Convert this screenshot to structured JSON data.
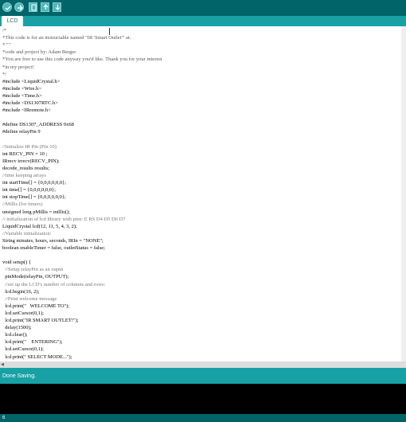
{
  "toolbar": {
    "buttons": [
      {
        "name": "verify-icon"
      },
      {
        "name": "upload-icon"
      },
      {
        "name": "new-file-icon"
      },
      {
        "name": "open-file-icon"
      },
      {
        "name": "save-file-icon"
      }
    ]
  },
  "tabs": [
    {
      "label": "LCD"
    }
  ],
  "editor": {
    "lines": [
      {
        "text": "/*",
        "color": "#555555"
      },
      {
        "text": "*This code is for an instructable named \"IR 'Smart Outlet'\" at:",
        "color": "#555555"
      },
      {
        "text": "* \"\"",
        "color": "#555555"
      },
      {
        "text": "*code and project by: Adam Berger",
        "color": "#555555"
      },
      {
        "text": "*You are free to use this code anyway you'd like. Thank you for your interest",
        "color": "#555555"
      },
      {
        "text": "*in my project!",
        "color": "#555555"
      },
      {
        "text": "*/",
        "color": "#555555"
      },
      {
        "text": "#include <LiquidCrystal.h>",
        "color": "#000000"
      },
      {
        "text": "#include <Wire.h>",
        "color": "#000000"
      },
      {
        "text": "#include <Time.h>",
        "color": "#000000"
      },
      {
        "text": "#include <DS1307RTC.h>",
        "color": "#000000"
      },
      {
        "text": "#include <IRremote.h>",
        "color": "#000000"
      },
      {
        "text": "",
        "color": "#000000"
      },
      {
        "text": "#define DS1307_ADDRESS 0x68",
        "color": "#000000"
      },
      {
        "text": "#define relayPin 9",
        "color": "#000000"
      },
      {
        "text": "",
        "color": "#000000"
      },
      {
        "text": "//Initialize IR Pin (Pin 10)",
        "color": "#777777"
      },
      {
        "text": "int RECV_PIN = 10 ;",
        "color": "#000000"
      },
      {
        "text": "IRrecv irrecv(RECV_PIN);",
        "color": "#000000"
      },
      {
        "text": "decode_results results;",
        "color": "#000000"
      },
      {
        "text": "//time keeping arrays",
        "color": "#777777"
      },
      {
        "text": "int startTime[] = {0,0,0,0,0,0};",
        "color": "#000000"
      },
      {
        "text": "int time[] = {0,0,0,0,0,0};",
        "color": "#000000"
      },
      {
        "text": "int stopTime[] = {0,0,0,0,0,0};",
        "color": "#000000"
      },
      {
        "text": "//Millis (for timers)",
        "color": "#777777"
      },
      {
        "text": "unsigned long pMillis = millis();",
        "color": "#000000"
      },
      {
        "text": "// initialization of lcd library with pins: E RS D4 D5 D6 D7",
        "color": "#777777"
      },
      {
        "text": "LiquidCrystal lcd(12, 11, 5, 4, 3, 2);",
        "color": "#000000"
      },
      {
        "text": "//Variable initialization:",
        "color": "#777777"
      },
      {
        "text": "String minutes, hours, seconds, IRIn = \"NONE\";",
        "color": "#000000"
      },
      {
        "text": "boolean enableTimer = false, outletStatus = false;",
        "color": "#000000"
      },
      {
        "text": "",
        "color": "#000000"
      },
      {
        "text": "void setup() {",
        "color": "#000000"
      },
      {
        "text": "  //Setup relayPin as an ouput",
        "color": "#777777"
      },
      {
        "text": "  pinMode(relayPin, OUTPUT);",
        "color": "#000000"
      },
      {
        "text": "  //set up the LCD's number of columns and rows:",
        "color": "#777777"
      },
      {
        "text": "  lcd.begin(16, 2);",
        "color": "#000000"
      },
      {
        "text": "  //Print welcome message",
        "color": "#777777"
      },
      {
        "text": "  lcd.print(\"   WELCOME TO\");",
        "color": "#000000"
      },
      {
        "text": "  lcd.setCursor(0,1);",
        "color": "#000000"
      },
      {
        "text": "  lcd.print(\"IR SMART OUTLET!\");",
        "color": "#000000"
      },
      {
        "text": "  delay(1500);",
        "color": "#000000"
      },
      {
        "text": "  lcd.clear();",
        "color": "#000000"
      },
      {
        "text": "  lcd.print(\"    ENTERING\");",
        "color": "#000000"
      },
      {
        "text": "  lcd.setCursor(0,1);",
        "color": "#000000"
      },
      {
        "text": "  lcd.print(\" SELECT MODE...\");",
        "color": "#000000"
      }
    ]
  },
  "status": {
    "message": "Done Saving."
  },
  "footer": {
    "line_number": "6"
  }
}
